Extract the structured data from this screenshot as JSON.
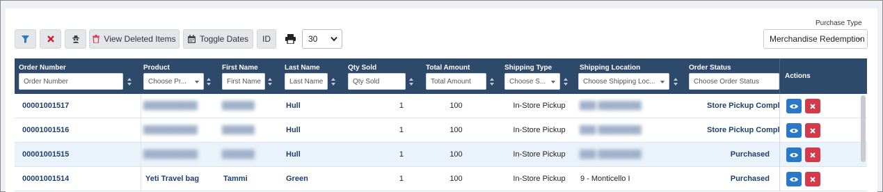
{
  "toolbar": {
    "view_deleted_label": "View Deleted Items",
    "toggle_dates_label": "Toggle Dates",
    "id_label": "ID",
    "page_size": "30"
  },
  "purchase_type": {
    "label": "Purchase Type",
    "value": "Merchandise Redemption"
  },
  "table": {
    "columns": [
      {
        "title": "Order Number",
        "placeholder": "Order Number"
      },
      {
        "title": "Product",
        "placeholder": "Choose Pr..."
      },
      {
        "title": "First Name",
        "placeholder": "First Name"
      },
      {
        "title": "Last Name",
        "placeholder": "Last Name"
      },
      {
        "title": "Qty Sold",
        "placeholder": "Qty Sold"
      },
      {
        "title": "Total Amount",
        "placeholder": "Total Amount"
      },
      {
        "title": "Shipping Type",
        "placeholder": "Choose S..."
      },
      {
        "title": "Shipping Location",
        "placeholder": "Choose Shipping Loc..."
      },
      {
        "title": "Order Status",
        "placeholder": "Choose Order Status"
      }
    ],
    "actions_title": "Actions",
    "rows": [
      {
        "order": "00001001517",
        "product": "",
        "first": "",
        "last": "Hull",
        "qty": "1",
        "total": "100",
        "ship_type": "In-Store Pickup",
        "ship_loc": "",
        "status": "Store Pickup Compl"
      },
      {
        "order": "00001001516",
        "product": "",
        "first": "",
        "last": "Hull",
        "qty": "1",
        "total": "100",
        "ship_type": "In-Store Pickup",
        "ship_loc": "",
        "status": "Store Pickup Compl"
      },
      {
        "order": "00001001515",
        "product": "",
        "first": "",
        "last": "Hull",
        "qty": "1",
        "total": "100",
        "ship_type": "In-Store Pickup",
        "ship_loc": "",
        "status": "Purchased"
      },
      {
        "order": "00001001514",
        "product": "Yeti Travel bag",
        "first": "Tammi",
        "last": "Green",
        "qty": "1",
        "total": "100",
        "ship_type": "In-Store Pickup",
        "ship_loc": "9 - Monticello I",
        "status": "Purchased"
      }
    ]
  }
}
